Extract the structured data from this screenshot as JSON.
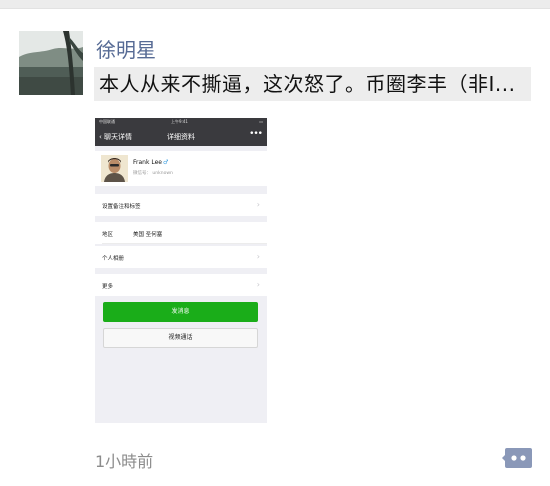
{
  "post": {
    "author": "徐明星",
    "text": "本人从来不撕逼，这次怒了。币圈李丰（非I...",
    "timestamp": "1小時前"
  },
  "embedded_screenshot": {
    "status_bar": {
      "carrier": "中国联通",
      "time": "上午9:41"
    },
    "nav": {
      "back_label": "聊天详情",
      "title": "详细资料",
      "more_label": "•••"
    },
    "profile": {
      "name": "Frank Lee",
      "wechat_id": "微信号：  unknown"
    },
    "rows": [
      {
        "label": "设置备注和标签",
        "value": ""
      },
      {
        "label": "地区",
        "value": "美国 圣何塞"
      },
      {
        "label": "个人相册",
        "value": ""
      },
      {
        "label": "更多",
        "value": ""
      }
    ],
    "primary_button": "发消息",
    "secondary_button": "视频通话"
  },
  "colors": {
    "author_name": "#576b95",
    "post_text_bg": "#ededed",
    "primary_button": "#1aad19",
    "comment_button": "#8a98b8"
  },
  "icons": {
    "comment": "comment-dots-icon",
    "back": "chevron-left-icon",
    "gender": "male-icon"
  }
}
